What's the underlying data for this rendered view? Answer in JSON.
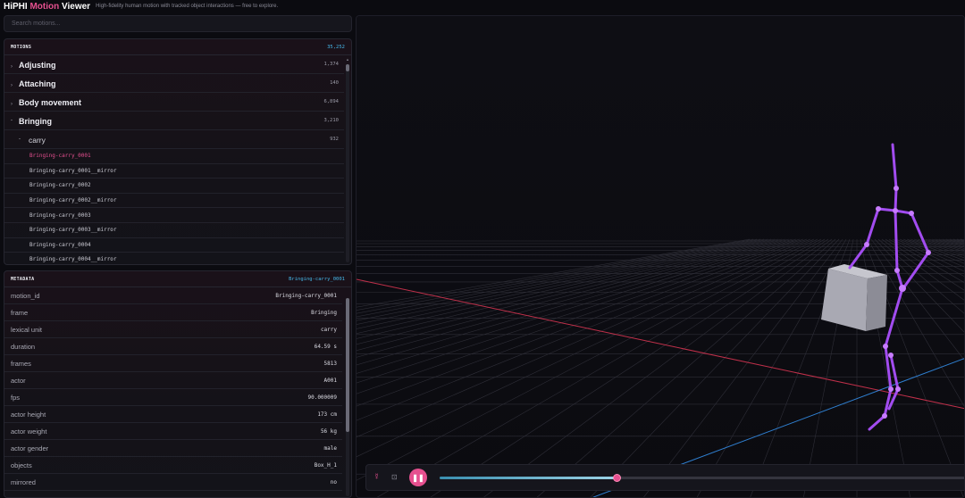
{
  "header": {
    "brand_prefix": "HiPHI",
    "brand_accent": "Motion",
    "brand_suffix": "Viewer",
    "tagline": "High-fidelity human motion with tracked object interactions — free to explore."
  },
  "search": {
    "placeholder": "Search motions..."
  },
  "motions": {
    "title": "MOTIONS",
    "total": "35,252",
    "categories": [
      {
        "label": "Adjusting",
        "count": "1,374",
        "expanded": false
      },
      {
        "label": "Attaching",
        "count": "140",
        "expanded": false
      },
      {
        "label": "Body movement",
        "count": "6,894",
        "expanded": false
      },
      {
        "label": "Bringing",
        "count": "3,210",
        "expanded": true
      }
    ],
    "subcategory": {
      "label": "carry",
      "count": "932"
    },
    "items": [
      "Bringing-carry_0001",
      "Bringing-carry_0001__mirror",
      "Bringing-carry_0002",
      "Bringing-carry_0002__mirror",
      "Bringing-carry_0003",
      "Bringing-carry_0003__mirror",
      "Bringing-carry_0004",
      "Bringing-carry_0004__mirror"
    ],
    "active_item": "Bringing-carry_0001"
  },
  "metadata": {
    "title": "METADATA",
    "selected": "Bringing-carry_0001",
    "rows": [
      {
        "key": "motion_id",
        "value": "Bringing-carry_0001"
      },
      {
        "key": "frame",
        "value": "Bringing"
      },
      {
        "key": "lexical unit",
        "value": "carry"
      },
      {
        "key": "duration",
        "value": "64.59 s"
      },
      {
        "key": "frames",
        "value": "5813"
      },
      {
        "key": "actor",
        "value": "A001"
      },
      {
        "key": "fps",
        "value": "90.000009"
      },
      {
        "key": "actor height",
        "value": "173 cm"
      },
      {
        "key": "actor weight",
        "value": "56 kg"
      },
      {
        "key": "actor gender",
        "value": "male"
      },
      {
        "key": "objects",
        "value": "Box_H_1"
      },
      {
        "key": "mirrored",
        "value": "no"
      }
    ]
  },
  "player": {
    "progress": 0.33,
    "icons": [
      "skeleton-icon",
      "focus-icon",
      "pause-icon"
    ]
  },
  "colors": {
    "accent": "#e5508f",
    "count_blue": "#46b7e8",
    "skeleton": "#a24cf0",
    "box": "#a8a8b2",
    "axis_x": "#c0304a",
    "axis_z": "#2f7fd0"
  }
}
